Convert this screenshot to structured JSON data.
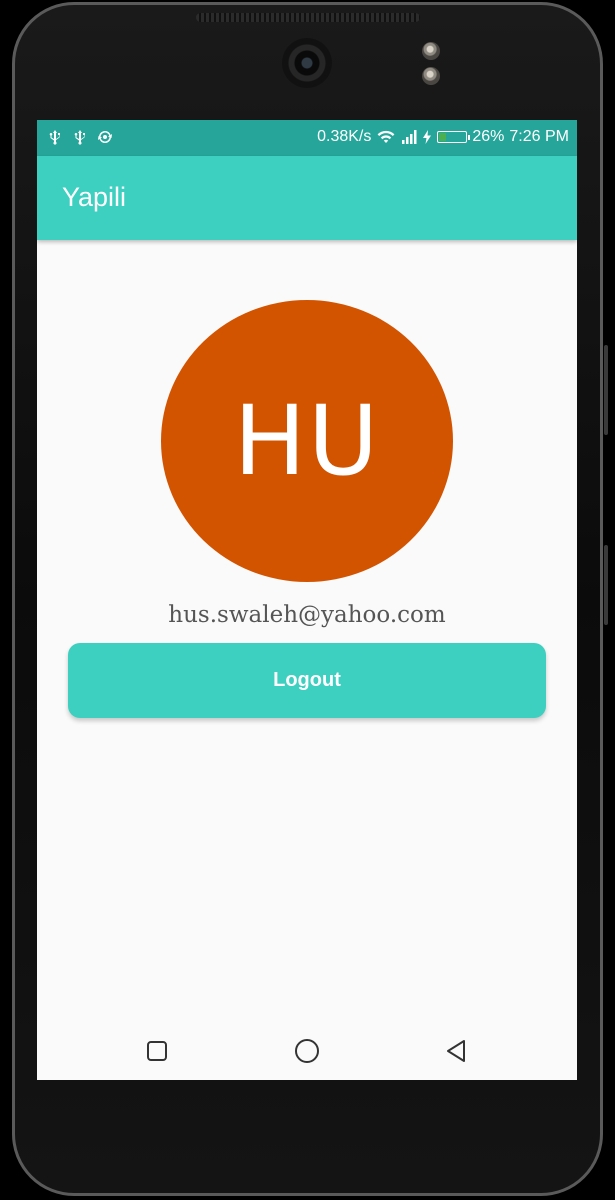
{
  "status_bar": {
    "network_speed": "0.38K/s",
    "battery_percent": "26%",
    "battery_level": 0.26,
    "time": "7:26 PM",
    "icons": [
      "usb-icon",
      "usb-icon",
      "sync-icon",
      "wifi-icon",
      "signal-icon",
      "charging-icon",
      "battery-icon"
    ]
  },
  "app_bar": {
    "title": "Yapili"
  },
  "profile": {
    "initials": "HU",
    "avatar_color": "#d35400",
    "email": "hus.swaleh@yahoo.com"
  },
  "actions": {
    "logout_label": "Logout"
  },
  "nav_bar": {
    "icons": [
      "recents-icon",
      "home-icon",
      "back-icon"
    ]
  },
  "colors": {
    "primary": "#3dcfc0",
    "status_bar": "#26a69a"
  }
}
